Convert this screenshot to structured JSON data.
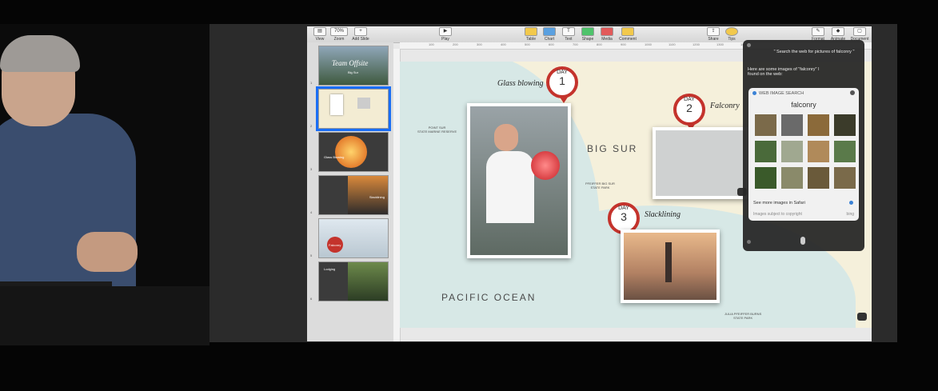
{
  "toolbar": {
    "view": "View",
    "zoom_value": "70%",
    "zoom": "Zoom",
    "add_slide": "Add Slide",
    "play": "Play",
    "table": "Table",
    "chart": "Chart",
    "text": "Text",
    "shape": "Shape",
    "media": "Media",
    "comment": "Comment",
    "share": "Share",
    "tips": "Tips",
    "format": "Format",
    "animate": "Animate",
    "document": "Document"
  },
  "ruler": [
    "100",
    "200",
    "300",
    "400",
    "500",
    "600",
    "700",
    "800",
    "900",
    "1000",
    "1100",
    "1200",
    "1300",
    "1400"
  ],
  "thumbnails": [
    {
      "title": "Team Offsite",
      "subtitle": "Big Sur"
    },
    {
      "title": ""
    },
    {
      "title": "Glass Blowing"
    },
    {
      "title": "Slacklining"
    },
    {
      "title": "Falconry"
    },
    {
      "title": "Lodging"
    }
  ],
  "slide": {
    "glass_blowing": "Glass blowing",
    "falconry": "Falconry",
    "slacklining": "Slacklining",
    "big_sur": "BIG SUR",
    "pacific_ocean": "PACIFIC OCEAN",
    "point_sur": "POINT SUR\nSTATE MARINE RESERVE",
    "pfeiffer_big_sur": "PFEIFFER BIG SUR\nSTATE PARK",
    "julia_pfeiffer": "JULIA PFEIFFER BURNS\nSTATE PARK",
    "day_label": "DAY",
    "day1": "1",
    "day2": "2",
    "day3": "3"
  },
  "siri": {
    "query": "\" Search the web for pictures of falconry \"",
    "response": "Here are some images of \"falconry\" I found on the web:",
    "card_header": "WEB IMAGE SEARCH",
    "card_title": "falconry",
    "see_more": "See more images in Safari",
    "copyright": "Images subject to copyright",
    "bing": "bing"
  },
  "colors": {
    "accent_blue": "#1a6ef5",
    "pin_red": "#c4332c",
    "map_sand": "#f5f0db",
    "map_water": "#d7e8e6"
  }
}
